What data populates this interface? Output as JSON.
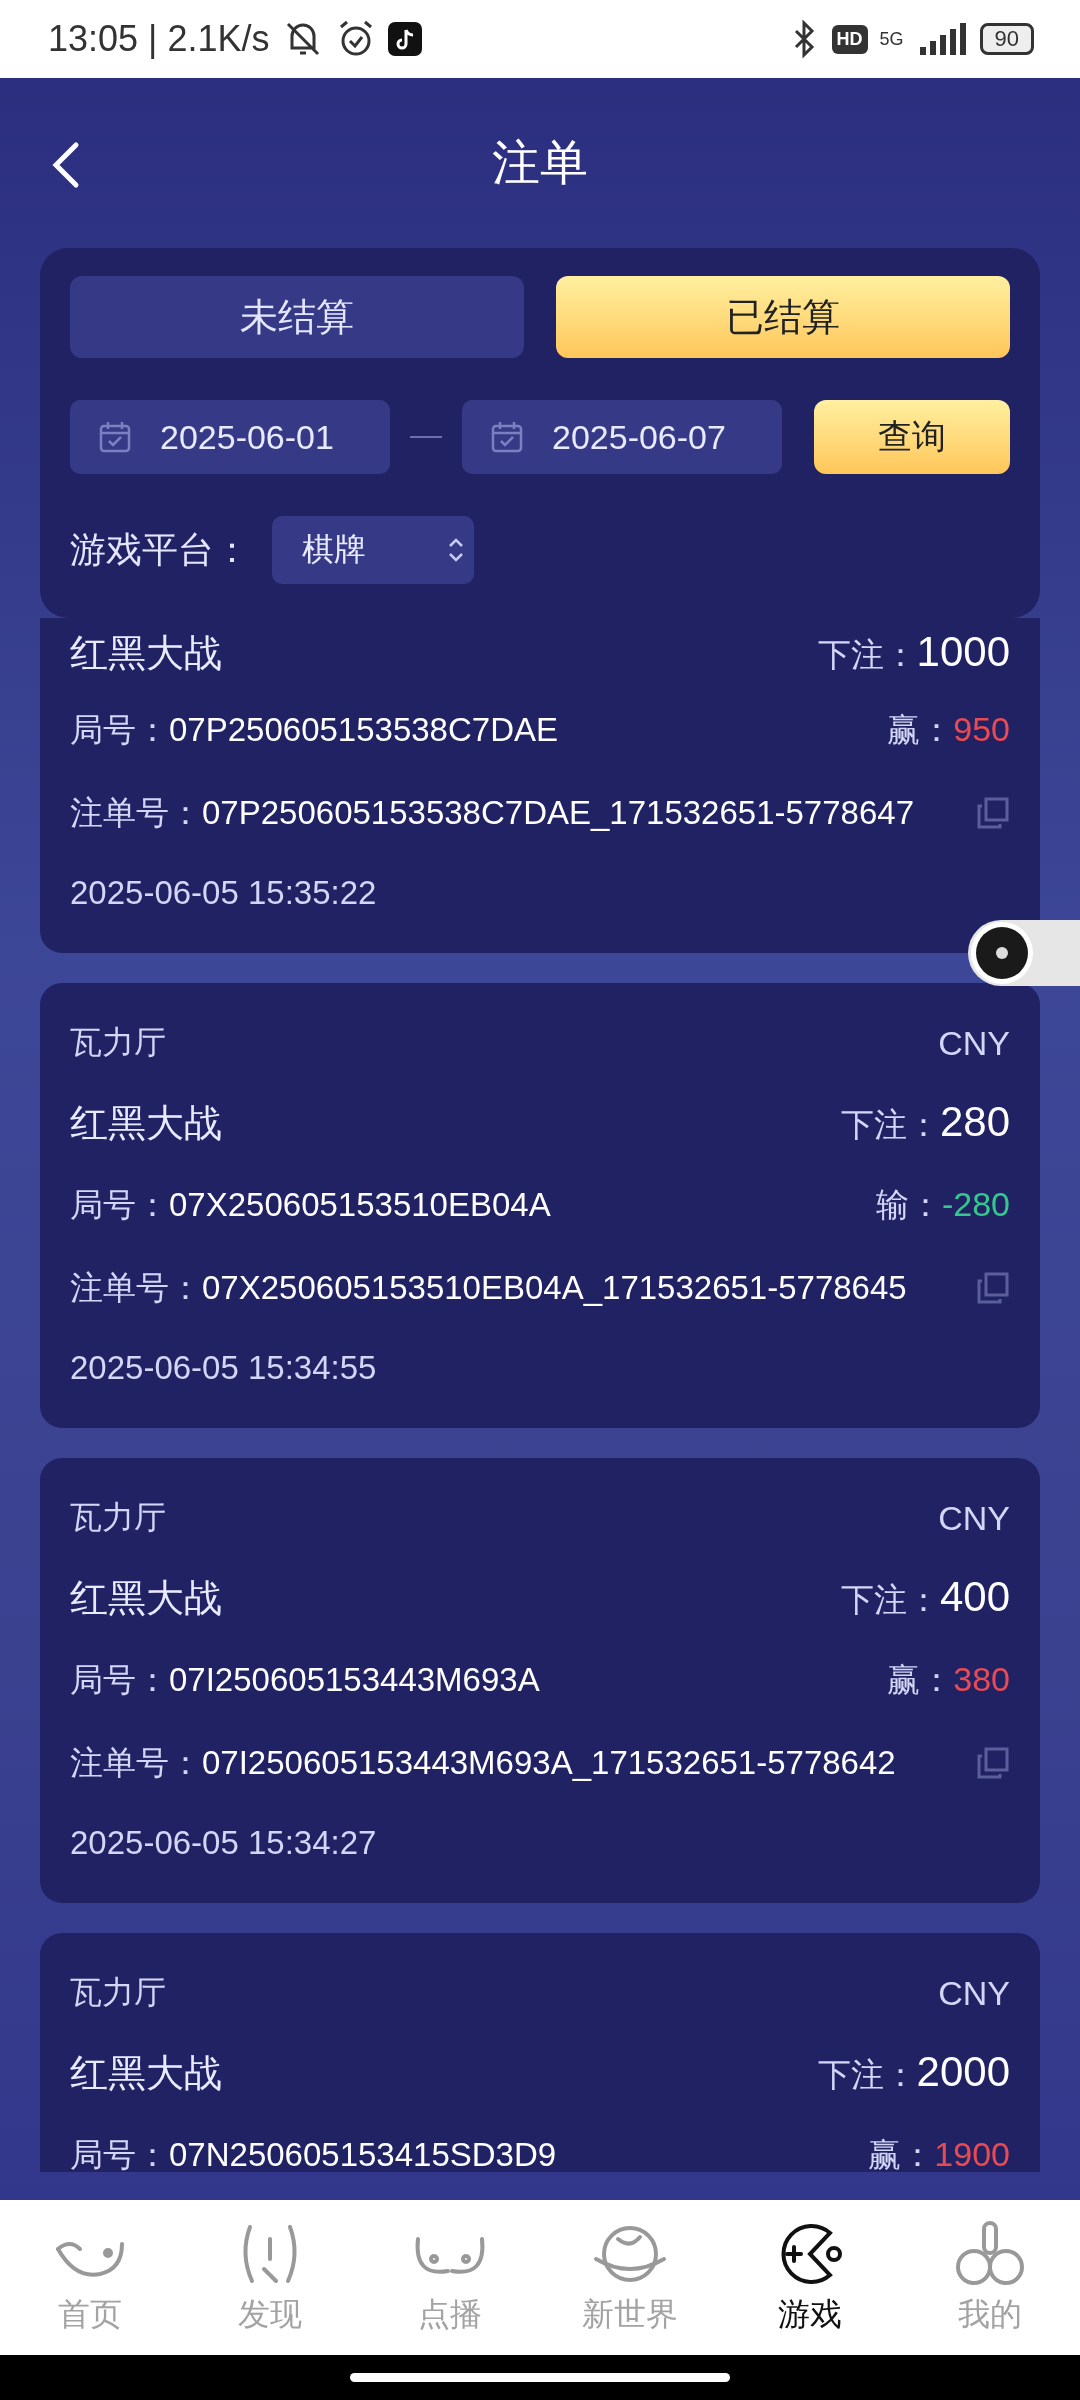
{
  "status_bar": {
    "time": "13:05 | 2.1K/s",
    "hd": "HD",
    "network": "5G",
    "battery": "90"
  },
  "header": {
    "title": "注单"
  },
  "filters": {
    "tabs": [
      {
        "label": "未结算",
        "selected": false
      },
      {
        "label": "已结算",
        "selected": true
      }
    ],
    "start_date": "2025-06-01",
    "end_date": "2025-06-07",
    "query_button": "查询",
    "platform_label": "游戏平台：",
    "platform_value": "棋牌"
  },
  "bets": [
    {
      "game": "红黑大战",
      "bet_label": "下注：",
      "bet": "1000",
      "round_label": "局号：",
      "round": "07P250605153538C7DAE",
      "color": "#ea4a52",
      "result_label": "赢：",
      "result": "950",
      "order_label": "注单号：",
      "order": "07P250605153538C7DAE_171532651-5778647",
      "time": "2025-06-05 15:35:22"
    },
    {
      "venue": "瓦力厅",
      "currency": "CNY",
      "game": "红黑大战",
      "bet_label": "下注：",
      "bet": "280",
      "round_label": "局号：",
      "round": "07X250605153510EB04A",
      "color": "#33c98d",
      "result_label": "输：",
      "result": "-280",
      "order_label": "注单号：",
      "order": "07X250605153510EB04A_171532651-5778645",
      "time": "2025-06-05 15:34:55"
    },
    {
      "venue": "瓦力厅",
      "currency": "CNY",
      "game": "红黑大战",
      "bet_label": "下注：",
      "bet": "400",
      "round_label": "局号：",
      "round": "07I250605153443M693A",
      "color": "#ea4a52",
      "result_label": "赢：",
      "result": "380",
      "order_label": "注单号：",
      "order": "07I250605153443M693A_171532651-5778642",
      "time": "2025-06-05 15:34:27"
    },
    {
      "venue": "瓦力厅",
      "currency": "CNY",
      "game": "红黑大战",
      "bet_label": "下注：",
      "bet": "2000",
      "round_label": "局号：",
      "round": "07N250605153415SD3D9",
      "color": "#ea4a52",
      "result_label": "赢：",
      "result": "1900"
    }
  ],
  "bottom_nav": [
    {
      "label": "首页",
      "selected": false
    },
    {
      "label": "发现",
      "selected": false
    },
    {
      "label": "点播",
      "selected": false
    },
    {
      "label": "新世界",
      "selected": false
    },
    {
      "label": "游戏",
      "selected": true
    },
    {
      "label": "我的",
      "selected": false
    }
  ]
}
